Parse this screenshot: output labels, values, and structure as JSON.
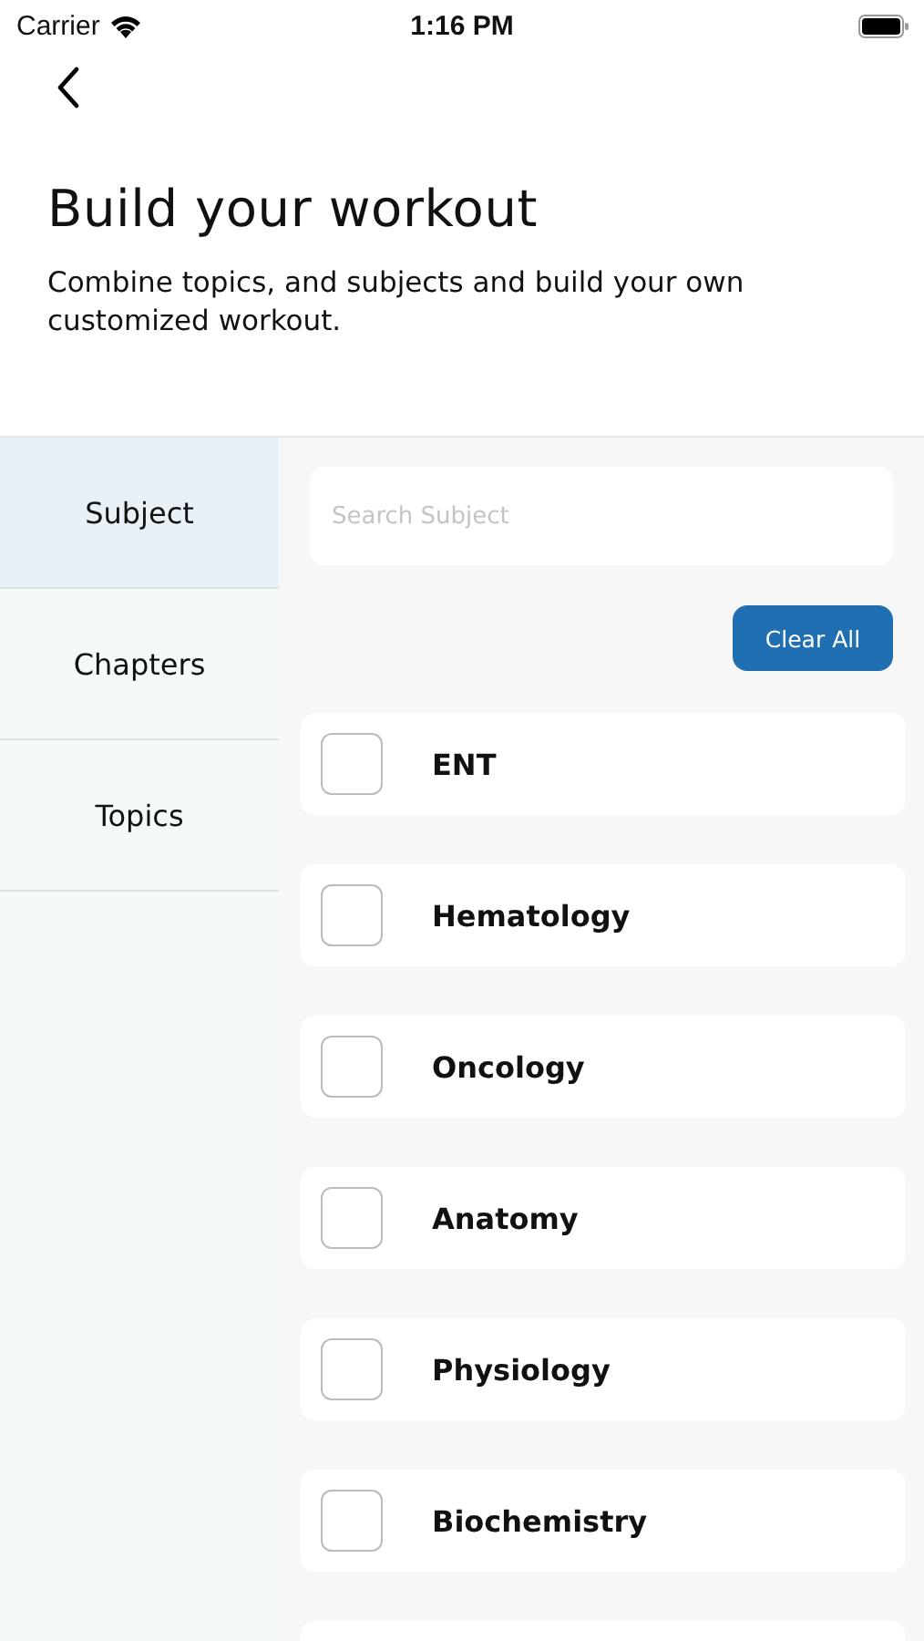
{
  "status_bar": {
    "carrier": "Carrier",
    "time": "1:16 PM"
  },
  "title": "Build your workout",
  "subtitle": "Combine topics, and subjects and build your own customized workout.",
  "tabs": [
    {
      "label": "Subject",
      "selected": true
    },
    {
      "label": "Chapters",
      "selected": false
    },
    {
      "label": "Topics",
      "selected": false
    }
  ],
  "search": {
    "placeholder": "Search Subject"
  },
  "clear_button": "Clear All",
  "subjects": [
    {
      "name": "ENT",
      "checked": false
    },
    {
      "name": "Hematology",
      "checked": false
    },
    {
      "name": "Oncology",
      "checked": false
    },
    {
      "name": "Anatomy",
      "checked": false
    },
    {
      "name": "Physiology",
      "checked": false
    },
    {
      "name": "Biochemistry",
      "checked": false
    }
  ]
}
